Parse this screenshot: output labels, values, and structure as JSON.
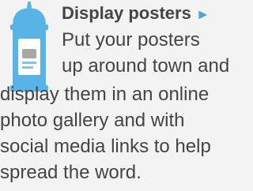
{
  "feature": {
    "icon": "poster-kiosk-icon",
    "title": "Display posters",
    "arrow": "►",
    "description_lines": [
      "Put your posters",
      "up around town and",
      "display them in an online",
      "photo gallery and with",
      "social media links to help",
      "spread the word."
    ]
  },
  "colors": {
    "background": "#f3f3f3",
    "text": "#444444",
    "accent": "#4aa3df"
  }
}
